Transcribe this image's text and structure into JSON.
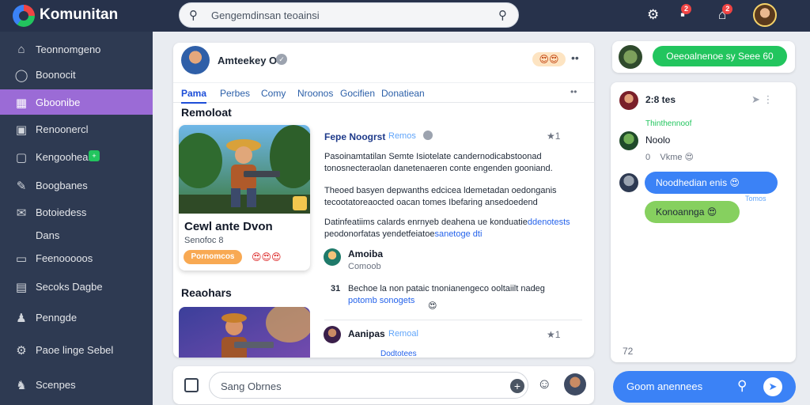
{
  "app": {
    "brand": "Komunitan"
  },
  "search": {
    "placeholder": "Gengemdinsan teoainsi"
  },
  "topbar": {
    "badge_messages": "2",
    "badge_home": "2"
  },
  "sidebar": {
    "items": [
      {
        "label": "Teonnomgeno",
        "icon": "home-icon"
      },
      {
        "label": "Boonocit",
        "icon": "compass-icon"
      },
      {
        "label": "Gboonibe",
        "icon": "grid-icon",
        "active": true
      },
      {
        "label": "Renoonercl",
        "icon": "calendar-icon"
      },
      {
        "label": "Kengoohean",
        "icon": "gamepad-icon",
        "badge": "+"
      },
      {
        "label": "Boogbanes",
        "icon": "pencil-icon"
      },
      {
        "label": "Botoiedess",
        "icon": "mail-icon"
      },
      {
        "label": "Dans",
        "icon": ""
      },
      {
        "label": "Feenooooos",
        "icon": "bookmark-icon"
      },
      {
        "label": "Secoks Dagbe",
        "icon": "book-icon"
      },
      {
        "label": "Penngde",
        "icon": "people-icon"
      },
      {
        "label": "Paoe linge Sebel",
        "icon": "settings-icon"
      },
      {
        "label": "Scenpes",
        "icon": "users-icon"
      }
    ]
  },
  "main": {
    "header": {
      "name": "Amteekey Ov",
      "reacts": "😍😍"
    },
    "tabs": [
      "Pama",
      "Perbes",
      "Comy",
      "Nroonos",
      "Gocifien",
      "Donatiean"
    ],
    "section1": "Remoloat",
    "section2": "Reaohars",
    "game": {
      "title": "Cewl ante Dvon",
      "subtitle": "Senofoc 8",
      "button": "Pornomcos",
      "reacts": "😍😍😍"
    },
    "post": {
      "title": "Fepe Noogrst",
      "tag": "Remos",
      "star": "★1",
      "lines": [
        {
          "text": "Pasoinamtatilan Semte Isiotelate candernodicabstoonad",
          "link": ""
        },
        {
          "text": "tonosnecteraolan danetenaeren conte engenden gooniand.",
          "link": ""
        },
        {
          "text": "Theoed basyen depwanths edcicea ldemetadan oedonganis",
          "link": ""
        },
        {
          "text": "tecootatoreaocted oacan tomes Ibefaring ansedoedend",
          "link": ""
        },
        {
          "text": "Datinfeatiims calards enrnyeb deahena ue konduatie",
          "link": "ddenotests"
        },
        {
          "text": "peodonorfatas yendetfeiatoe",
          "link": "sanetoge dti"
        }
      ]
    },
    "comment1": {
      "name": "Amoiba",
      "sub": "Comoob",
      "num": "31",
      "line1": "Bechoe la non pataic tnonianengeco ooltaiilt nadeg",
      "line2": "potomb sonogets",
      "emoji": "😍"
    },
    "comment2": {
      "name": "Aanipas",
      "tag": "Remoal",
      "star": "★1",
      "bottom": "Dodtotees"
    }
  },
  "composer": {
    "placeholder": "Sang Obrnes"
  },
  "right": {
    "top_button": "Oeeoalnenoe sy Seee 60",
    "chat": {
      "head": "2:8 tes",
      "label": "Thinthennoof",
      "name": "Noolo",
      "small_num": "0",
      "small_text": "Vkme",
      "bubble_blue": "Noodhedian enis",
      "bubble_green": "Konoannga",
      "meta": "Tomos",
      "count": "72"
    },
    "bottom": {
      "label": "Goom anennees"
    }
  }
}
